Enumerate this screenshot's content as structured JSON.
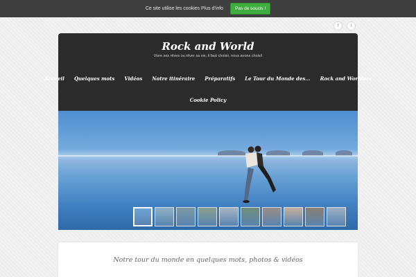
{
  "cookie_bar": {
    "text": "Ce site utilise les cookies Plus d'info",
    "button_label": "Pas de soucis !"
  },
  "social": {
    "facebook_glyph": "f",
    "twitter_glyph": "t"
  },
  "site": {
    "title": "Rock and World",
    "tagline": "Vivre ses rêves ou rêver sa vie, il faut choisir, nous avons choisi!"
  },
  "nav": {
    "items": [
      {
        "label": "Accueil"
      },
      {
        "label": "Quelques mots"
      },
      {
        "label": "Vidéos"
      },
      {
        "label": "Notre itinéraire"
      },
      {
        "label": "Préparatifs"
      },
      {
        "label": "Le Tour du Monde des..."
      },
      {
        "label": "Rock and Worlders"
      },
      {
        "label": "Cookie Policy"
      }
    ]
  },
  "slider": {
    "thumbnail_colors": [
      "#6ea4d6",
      "#8fb2c9",
      "#7c9aa3",
      "#8a9f8e",
      "#a7b4c2",
      "#6f8f7a",
      "#9a8e86",
      "#c6b09e",
      "#8a7f74",
      "#9db0c4"
    ]
  },
  "content": {
    "title": "Notre tour du monde en quelques mots, photos & vidéos"
  },
  "colors": {
    "header_bg": "#2a2a2a",
    "cookie_bar_bg": "#3f3f3f",
    "accept_button": "#3fae3f"
  }
}
